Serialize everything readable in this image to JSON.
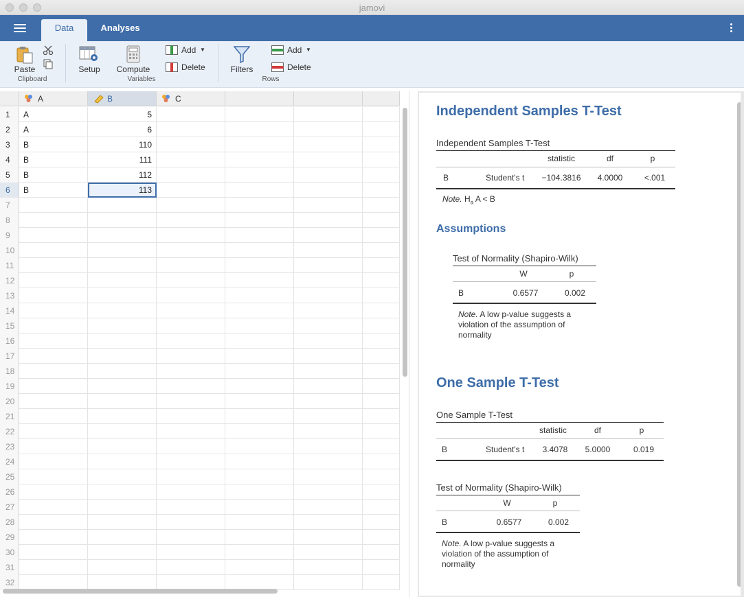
{
  "window": {
    "title": "jamovi"
  },
  "tabs": [
    {
      "label": "Data",
      "active": true
    },
    {
      "label": "Analyses",
      "active": false
    }
  ],
  "ribbon": {
    "clipboard": {
      "paste_label": "Paste",
      "group_label": "Clipboard"
    },
    "variables": {
      "setup_label": "Setup",
      "compute_label": "Compute",
      "add_label": "Add",
      "delete_label": "Delete",
      "group_label": "Variables"
    },
    "rows": {
      "filters_label": "Filters",
      "add_label": "Add",
      "delete_label": "Delete",
      "group_label": "Rows"
    }
  },
  "spreadsheet": {
    "columns": [
      {
        "name": "A",
        "icon": "nominal-icon"
      },
      {
        "name": "B",
        "icon": "continuous-icon"
      },
      {
        "name": "C",
        "icon": "nominal-icon"
      }
    ],
    "rows": [
      {
        "n": "1",
        "a": "A",
        "b": "5"
      },
      {
        "n": "2",
        "a": "A",
        "b": "6"
      },
      {
        "n": "3",
        "a": "B",
        "b": "110"
      },
      {
        "n": "4",
        "a": "B",
        "b": "111"
      },
      {
        "n": "5",
        "a": "B",
        "b": "112"
      },
      {
        "n": "6",
        "a": "B",
        "b": "113"
      }
    ],
    "empty_row_numbers": [
      "7",
      "8",
      "9",
      "10",
      "11",
      "12",
      "13",
      "14",
      "15",
      "16",
      "17",
      "18",
      "19",
      "20",
      "21",
      "22",
      "23",
      "24",
      "25",
      "26",
      "27",
      "28",
      "29",
      "30",
      "31",
      "32"
    ],
    "selected_row": "6"
  },
  "results": {
    "independent": {
      "heading": "Independent Samples T-Test",
      "table_title": "Independent Samples T-Test",
      "headers": {
        "statistic": "statistic",
        "df": "df",
        "p": "p"
      },
      "row": {
        "var": "B",
        "test": "Student's t",
        "statistic": "−104.3816",
        "df": "4.0000",
        "p": "<.001"
      },
      "note_label": "Note.",
      "note_h": "H",
      "note_sub": "a",
      "note_text": " A < B"
    },
    "assumptions": {
      "heading": "Assumptions",
      "table_title": "Test of Normality (Shapiro-Wilk)",
      "headers": {
        "w": "W",
        "p": "p"
      },
      "row": {
        "var": "B",
        "w": "0.6577",
        "p": "0.002"
      },
      "note_label": "Note.",
      "note_text": " A low p-value suggests a violation of the assumption of normality"
    },
    "one_sample": {
      "heading": "One Sample T-Test",
      "table_title": "One Sample T-Test",
      "headers": {
        "statistic": "statistic",
        "df": "df",
        "p": "p"
      },
      "row": {
        "var": "B",
        "test": "Student's t",
        "statistic": "3.4078",
        "df": "5.0000",
        "p": "0.019"
      }
    },
    "normality2": {
      "table_title": "Test of Normality (Shapiro-Wilk)",
      "headers": {
        "w": "W",
        "p": "p"
      },
      "row": {
        "var": "B",
        "w": "0.6577",
        "p": "0.002"
      },
      "note_label": "Note.",
      "note_text": " A low p-value suggests a violation of the assumption of normality"
    }
  },
  "colors": {
    "accent": "#3e6da9"
  }
}
